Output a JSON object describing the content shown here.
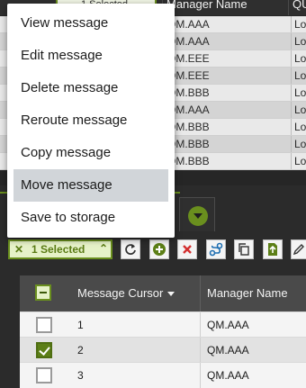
{
  "top_table": {
    "selected_label": "1 Selected",
    "columns": [
      "Manager Name",
      "QU"
    ],
    "rows": [
      {
        "manager": "QM.AAA",
        "q": "Lo"
      },
      {
        "manager": "QM.AAA",
        "q": "Lo"
      },
      {
        "manager": "QM.EEE",
        "q": "Lo"
      },
      {
        "manager": "QM.EEE",
        "q": "Lo"
      },
      {
        "manager": "QM.BBB",
        "q": "Lo"
      },
      {
        "manager": "QM.AAA",
        "q": "Lo"
      },
      {
        "manager": "QM.BBB",
        "q": "Lo"
      },
      {
        "manager": "QM.BBB",
        "q": "Lo"
      },
      {
        "manager": "QM.BBB",
        "q": "Lo"
      }
    ]
  },
  "context_menu": {
    "items": [
      {
        "label": "View message"
      },
      {
        "label": "Edit message"
      },
      {
        "label": "Delete message"
      },
      {
        "label": "Reroute message"
      },
      {
        "label": "Copy message"
      },
      {
        "label": "Move message",
        "highlighted": true
      },
      {
        "label": "Save to storage"
      }
    ]
  },
  "toolbar": {
    "selected_label": "1 Selected",
    "clear_icon": "x-icon",
    "caret_icon": "chevron-up-icon",
    "buttons": [
      {
        "name": "refresh-icon",
        "color": "#333333"
      },
      {
        "name": "add-icon",
        "color": "#5c7f17"
      },
      {
        "name": "delete-icon",
        "color": "#d32f2f"
      },
      {
        "name": "route-icon",
        "color": "#1f6fb2"
      },
      {
        "name": "copy-icon",
        "color": "#333333"
      },
      {
        "name": "export-icon",
        "color": "#5c7f17"
      },
      {
        "name": "edit-icon",
        "color": "#333333"
      }
    ]
  },
  "bottom_table": {
    "columns": {
      "cursor": "Message Cursor",
      "manager": "Manager Name"
    },
    "sort": "descending",
    "rows": [
      {
        "checked": false,
        "cursor": "1",
        "manager": "QM.AAA"
      },
      {
        "checked": true,
        "cursor": "2",
        "manager": "QM.AAA"
      },
      {
        "checked": false,
        "cursor": "3",
        "manager": "QM.AAA"
      }
    ]
  },
  "colors": {
    "accent": "#6a8f1e",
    "highlight": "#d1d5d9",
    "panel": "#2b2b2b"
  }
}
